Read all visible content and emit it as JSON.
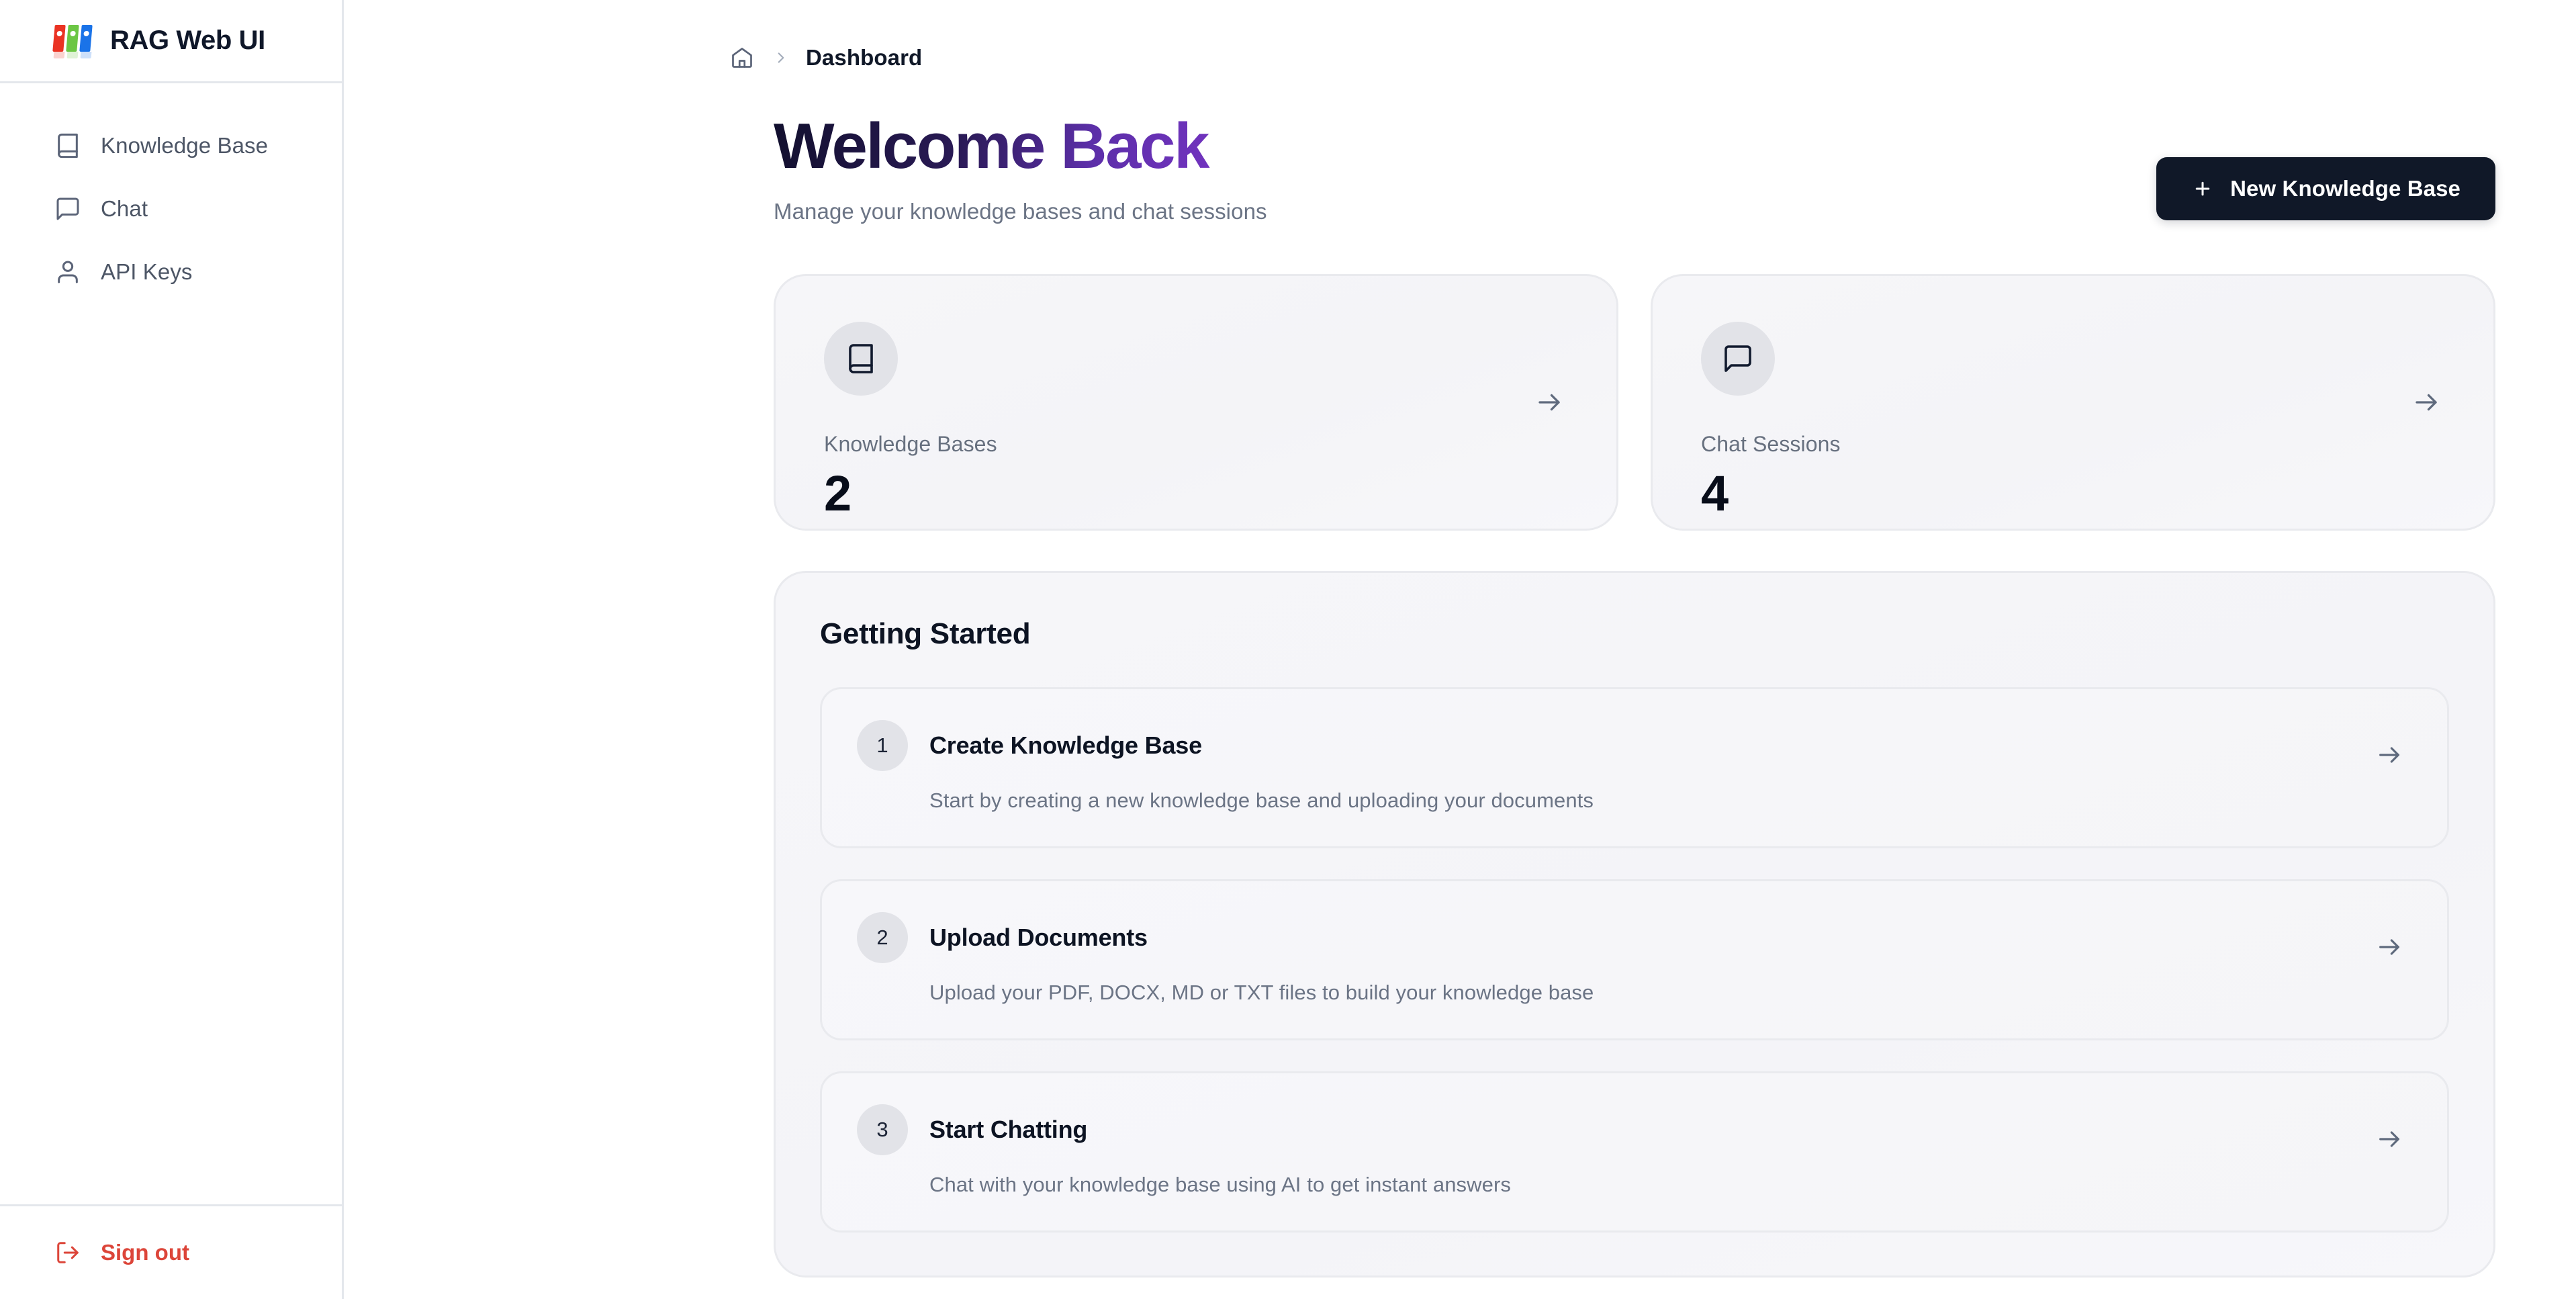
{
  "app": {
    "title": "RAG Web UI",
    "logo_icon": "rag-books-logo",
    "brand_colors": [
      "#ea3323",
      "#6cc644",
      "#1a73e8"
    ]
  },
  "sidebar": {
    "items": [
      {
        "label": "Knowledge Base",
        "icon": "book-icon"
      },
      {
        "label": "Chat",
        "icon": "message-square-icon"
      },
      {
        "label": "API Keys",
        "icon": "user-icon"
      }
    ],
    "signout": {
      "label": "Sign out",
      "icon": "log-out-icon",
      "color": "#dc4539"
    }
  },
  "breadcrumb": {
    "home_icon": "home-icon",
    "separator": "chevron-right-icon",
    "current": "Dashboard"
  },
  "header": {
    "title_primary": "Welcome",
    "title_accent": "Back",
    "subtitle": "Manage your knowledge bases and chat sessions",
    "gradient_from": "#12102e",
    "gradient_to": "#7b35c9"
  },
  "actions": {
    "new_kb_label": "New Knowledge Base",
    "new_kb_icon": "plus-icon",
    "new_kb_bg": "#101828"
  },
  "stats": [
    {
      "label": "Knowledge Bases",
      "value": "2",
      "icon": "book-icon",
      "arrow": "arrow-right-icon"
    },
    {
      "label": "Chat Sessions",
      "value": "4",
      "icon": "message-square-icon",
      "arrow": "arrow-right-icon"
    }
  ],
  "getting_started": {
    "title": "Getting Started",
    "steps": [
      {
        "number": "1",
        "title": "Create Knowledge Base",
        "description": "Start by creating a new knowledge base and uploading your documents",
        "arrow": "arrow-right-icon"
      },
      {
        "number": "2",
        "title": "Upload Documents",
        "description": "Upload your PDF, DOCX, MD or TXT files to build your knowledge base",
        "arrow": "arrow-right-icon"
      },
      {
        "number": "3",
        "title": "Start Chatting",
        "description": "Chat with your knowledge base using AI to get instant answers",
        "arrow": "arrow-right-icon"
      }
    ]
  }
}
